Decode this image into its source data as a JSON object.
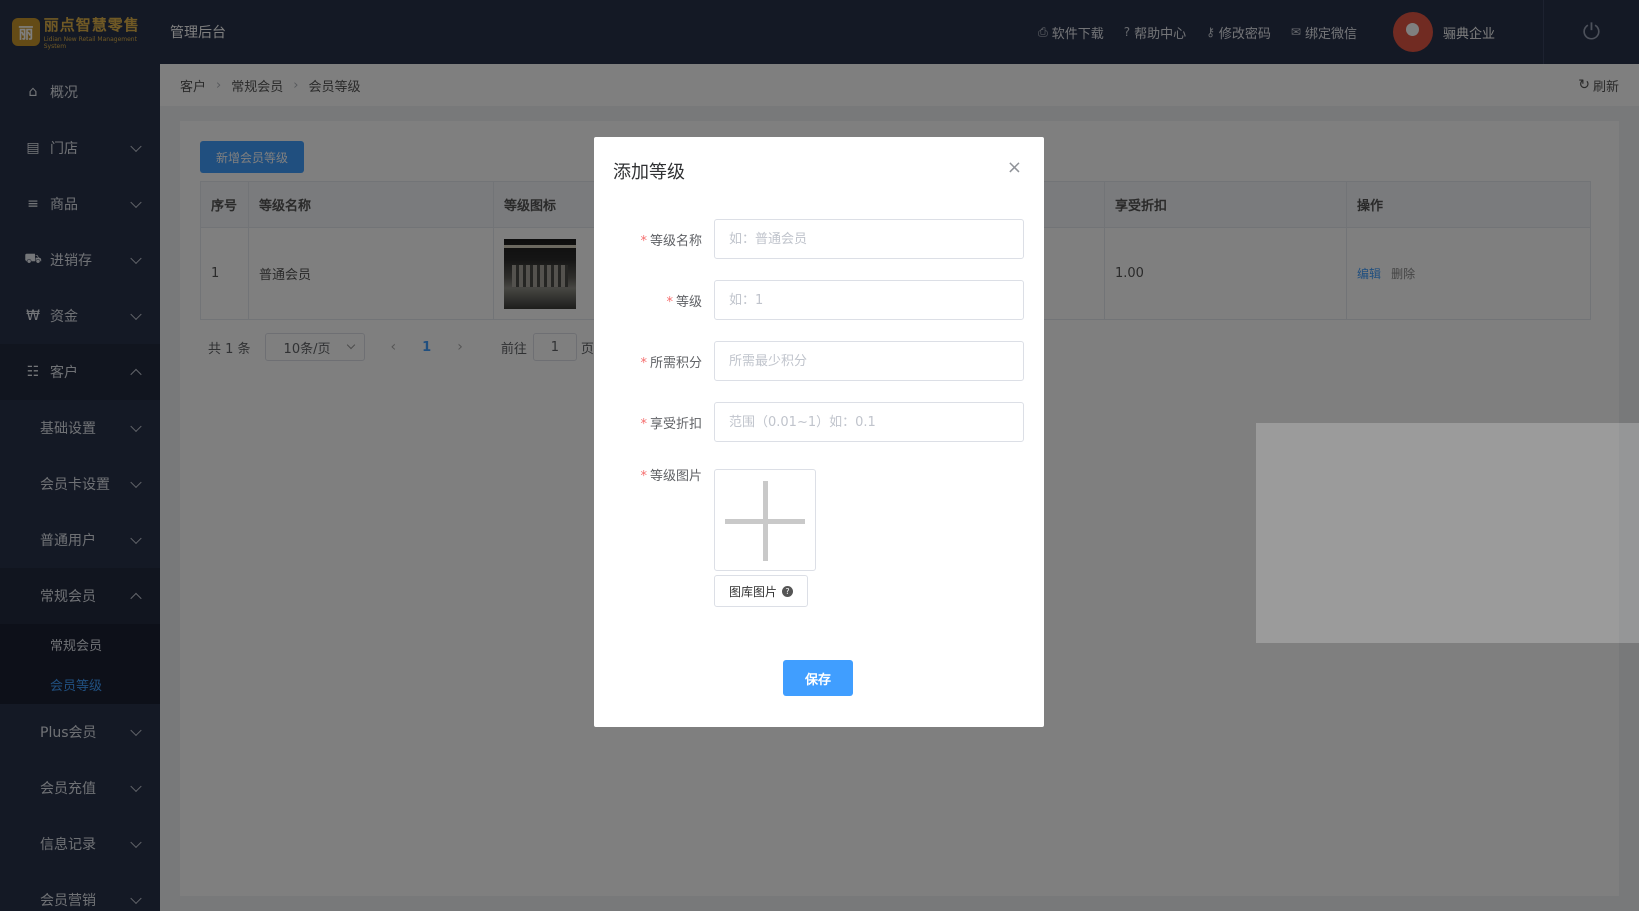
{
  "header": {
    "logo_title": "丽点智慧零售",
    "logo_sub": "Lidian New Retail Management System",
    "admin_title": "管理后台",
    "links": [
      {
        "label": "软件下载",
        "icon": "printer-icon",
        "glyph": "⎙"
      },
      {
        "label": "帮助中心",
        "icon": "help-icon",
        "glyph": "?"
      },
      {
        "label": "修改密码",
        "icon": "key-icon",
        "glyph": "⚷"
      },
      {
        "label": "绑定微信",
        "icon": "wechat-icon",
        "glyph": "✉"
      }
    ],
    "user_name": "骊典企业",
    "power_glyph": "⏻"
  },
  "sidebar": {
    "items": [
      {
        "label": "概况",
        "glyph": "⌂"
      },
      {
        "label": "门店",
        "glyph": "▤"
      },
      {
        "label": "商品",
        "glyph": "≡"
      },
      {
        "label": "进销存",
        "glyph": "⛟"
      },
      {
        "label": "资金",
        "glyph": "₩"
      },
      {
        "label": "客户",
        "glyph": "☷"
      }
    ],
    "sub_items": [
      {
        "label": "基础设置"
      },
      {
        "label": "会员卡设置"
      },
      {
        "label": "普通用户"
      },
      {
        "label": "常规会员"
      }
    ],
    "leaves": [
      {
        "label": "常规会员"
      },
      {
        "label": "会员等级"
      }
    ],
    "more_items": [
      {
        "label": "Plus会员"
      },
      {
        "label": "会员充值"
      },
      {
        "label": "信息记录"
      },
      {
        "label": "会员营销"
      }
    ]
  },
  "breadcrumb": {
    "items": [
      "客户",
      "常规会员",
      "会员等级"
    ],
    "refresh_label": "刷新"
  },
  "toolbar": {
    "add_label": "新增会员等级"
  },
  "table": {
    "columns": [
      "序号",
      "等级名称",
      "等级图标",
      "享受折扣",
      "操作"
    ],
    "rows": [
      {
        "index": "1",
        "name": "普通会员",
        "discount": "1.00",
        "edit": "编辑",
        "delete": "删除"
      }
    ]
  },
  "pagination": {
    "total": "共 1 条",
    "page_size": "10条/页",
    "current_page": "1",
    "goto_label": "前往",
    "goto_value": "1",
    "page_suffix": "页"
  },
  "dialog": {
    "title": "添加等级",
    "close_glyph": "×",
    "fields": [
      {
        "label": "等级名称",
        "placeholder": "如：普通会员"
      },
      {
        "label": "等级",
        "placeholder": "如：1"
      },
      {
        "label": "所需积分",
        "placeholder": "所需最少积分"
      },
      {
        "label": "享受折扣",
        "placeholder": "范围（0.01~1）如：0.1"
      }
    ],
    "image_label": "等级图片",
    "gallery_label": "图库图片",
    "save_label": "保存"
  }
}
